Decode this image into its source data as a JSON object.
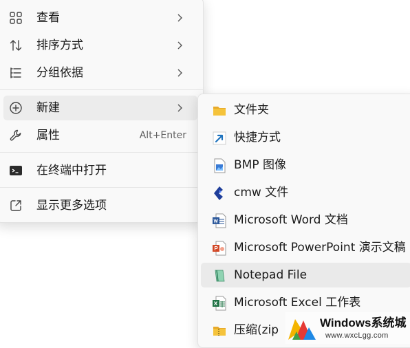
{
  "context_menu": {
    "items": [
      {
        "label": "查看",
        "icon": "view-grid-icon"
      },
      {
        "label": "排序方式",
        "icon": "sort-arrows-icon"
      },
      {
        "label": "分组依据",
        "icon": "group-list-icon"
      },
      {
        "label": "新建",
        "icon": "new-plus-circle-icon"
      },
      {
        "label": "属性",
        "icon": "wrench-icon",
        "shortcut": "Alt+Enter"
      },
      {
        "label": "在终端中打开",
        "icon": "terminal-icon"
      },
      {
        "label": "显示更多选项",
        "icon": "show-more-options-icon"
      }
    ]
  },
  "new_submenu": {
    "items": [
      {
        "label": "文件夹",
        "icon": "folder-icon"
      },
      {
        "label": "快捷方式",
        "icon": "shortcut-arrow-icon"
      },
      {
        "label": "BMP 图像",
        "icon": "bmp-image-icon"
      },
      {
        "label": "cmw 文件",
        "icon": "cmw-file-icon"
      },
      {
        "label": "Microsoft Word 文档",
        "icon": "word-doc-icon"
      },
      {
        "label": "Microsoft PowerPoint 演示文稿",
        "icon": "powerpoint-icon"
      },
      {
        "label": "Notepad File",
        "icon": "notepad-icon"
      },
      {
        "label": "Microsoft Excel 工作表",
        "icon": "excel-icon"
      },
      {
        "label": "压缩(zip",
        "icon": "zip-folder-icon"
      }
    ]
  },
  "watermark": {
    "title": "Windows系统城",
    "url": "www.wxcLgg.com"
  },
  "colors": {
    "menu_bg": "#f9f9f9",
    "highlight": "#ececec",
    "folder": "#f5c33b",
    "word": "#2b579a",
    "powerpoint": "#d24726",
    "excel": "#217346"
  }
}
